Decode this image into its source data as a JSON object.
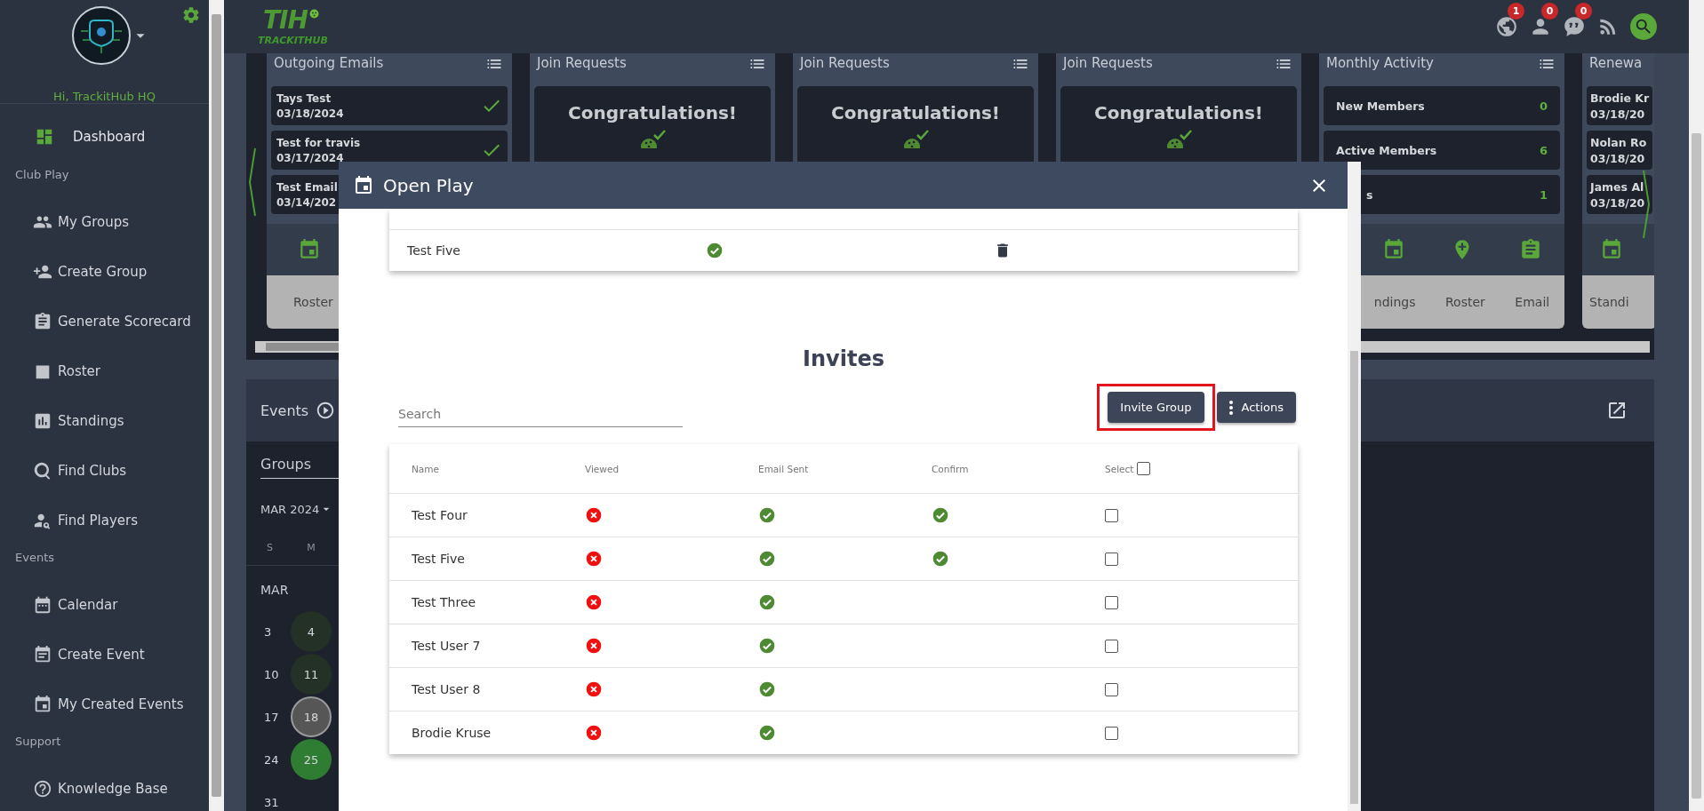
{
  "sidebar": {
    "greeting": "Hi, TrackitHub HQ",
    "nav": [
      {
        "label": "Dashboard",
        "selected": true
      }
    ],
    "sections": [
      {
        "title": "Club Play",
        "items": [
          {
            "label": "My Groups",
            "selected": false
          },
          {
            "label": "Create Group",
            "selected": false
          },
          {
            "label": "Generate Scorecard",
            "selected": false
          },
          {
            "label": "Roster",
            "selected": false
          },
          {
            "label": "Standings",
            "selected": false
          },
          {
            "label": "Find Clubs",
            "selected": false
          },
          {
            "label": "Find Players",
            "selected": false
          }
        ]
      },
      {
        "title": "Events",
        "items": [
          {
            "label": "Calendar",
            "selected": false
          },
          {
            "label": "Create Event",
            "selected": false
          },
          {
            "label": "My Created Events",
            "selected": false
          }
        ]
      },
      {
        "title": "Support",
        "items": [
          {
            "label": "Knowledge Base",
            "selected": false
          }
        ]
      }
    ]
  },
  "top_bar": {
    "logo": {
      "mark": "TIH",
      "name": "TRACKITHUB"
    },
    "notifications": [
      {
        "count": "1"
      },
      {
        "count": "0"
      },
      {
        "count": "0"
      }
    ]
  },
  "dashboard_cards": [
    {
      "kind": "emails",
      "title": "Outgoing Emails",
      "items": [
        {
          "name": "Tays Test",
          "date": "03/18/2024",
          "sent": true
        },
        {
          "name": "Test for travis",
          "date": "03/17/2024",
          "sent": true
        },
        {
          "name": "Test Email",
          "date": "03/14/202",
          "sent": false
        }
      ],
      "actions": [
        {
          "label": "Roster"
        }
      ]
    },
    {
      "kind": "message",
      "title": "Join Requests",
      "message": "Congratulations!"
    },
    {
      "kind": "message",
      "title": "Join Requests",
      "message": "Congratulations!"
    },
    {
      "kind": "message",
      "title": "Join Requests",
      "message": "Congratulations!"
    },
    {
      "kind": "stats",
      "title": "Monthly Activity",
      "items": [
        {
          "label": "New Members",
          "value": "0"
        },
        {
          "label": "Active Members",
          "value": "6"
        },
        {
          "label": "s",
          "value": "1"
        }
      ],
      "actions": [
        {
          "label": "ndings"
        },
        {
          "label": "Roster"
        },
        {
          "label": "Email"
        }
      ]
    },
    {
      "kind": "renewals",
      "title": "Renewa",
      "items": [
        {
          "name": "Brodie Kr",
          "date": "03/18/20"
        },
        {
          "name": "Nolan Ro",
          "date": "03/18/20"
        },
        {
          "name": "James Al",
          "date": "03/18/20"
        }
      ],
      "actions": [
        {
          "label": "Standi"
        }
      ]
    }
  ],
  "events": {
    "title": "Events",
    "tab": "Groups",
    "month": "MAR 2024",
    "weekdays": [
      "S",
      "M"
    ],
    "month_label": "MAR",
    "weeks": [
      [
        {
          "day": "3",
          "kind": "plain"
        },
        {
          "day": "4",
          "kind": "event"
        }
      ],
      [
        {
          "day": "10",
          "kind": "plain"
        },
        {
          "day": "11",
          "kind": "event"
        }
      ],
      [
        {
          "day": "17",
          "kind": "plain"
        },
        {
          "day": "18",
          "kind": "today"
        }
      ],
      [
        {
          "day": "24",
          "kind": "plain"
        },
        {
          "day": "25",
          "kind": "selected"
        }
      ],
      [
        {
          "day": "31",
          "kind": "plain"
        }
      ]
    ]
  },
  "modal": {
    "title": "Open Play",
    "members": [
      {
        "name": "Test Five",
        "confirmed": true
      }
    ],
    "invites": {
      "title": "Invites",
      "search": {
        "placeholder": "Search"
      },
      "buttons": [
        {
          "label": "Invite Group",
          "highlighted": true
        },
        {
          "label": "Actions",
          "highlighted": false
        }
      ],
      "columns": [
        "Name",
        "Viewed",
        "Email Sent",
        "Confirm",
        "Select"
      ],
      "select_all": false,
      "rows": [
        {
          "name": "Test Four",
          "viewed": false,
          "email_sent": true,
          "confirmed": true,
          "selected": false
        },
        {
          "name": "Test Five",
          "viewed": false,
          "email_sent": true,
          "confirmed": true,
          "selected": false
        },
        {
          "name": "Test Three",
          "viewed": false,
          "email_sent": true,
          "confirmed": false,
          "selected": false
        },
        {
          "name": "Test User 7",
          "viewed": false,
          "email_sent": true,
          "confirmed": false,
          "selected": false
        },
        {
          "name": "Test User 8",
          "viewed": false,
          "email_sent": true,
          "confirmed": false,
          "selected": false
        },
        {
          "name": "Brodie Kruse",
          "viewed": false,
          "email_sent": true,
          "confirmed": false,
          "selected": false
        }
      ]
    }
  }
}
